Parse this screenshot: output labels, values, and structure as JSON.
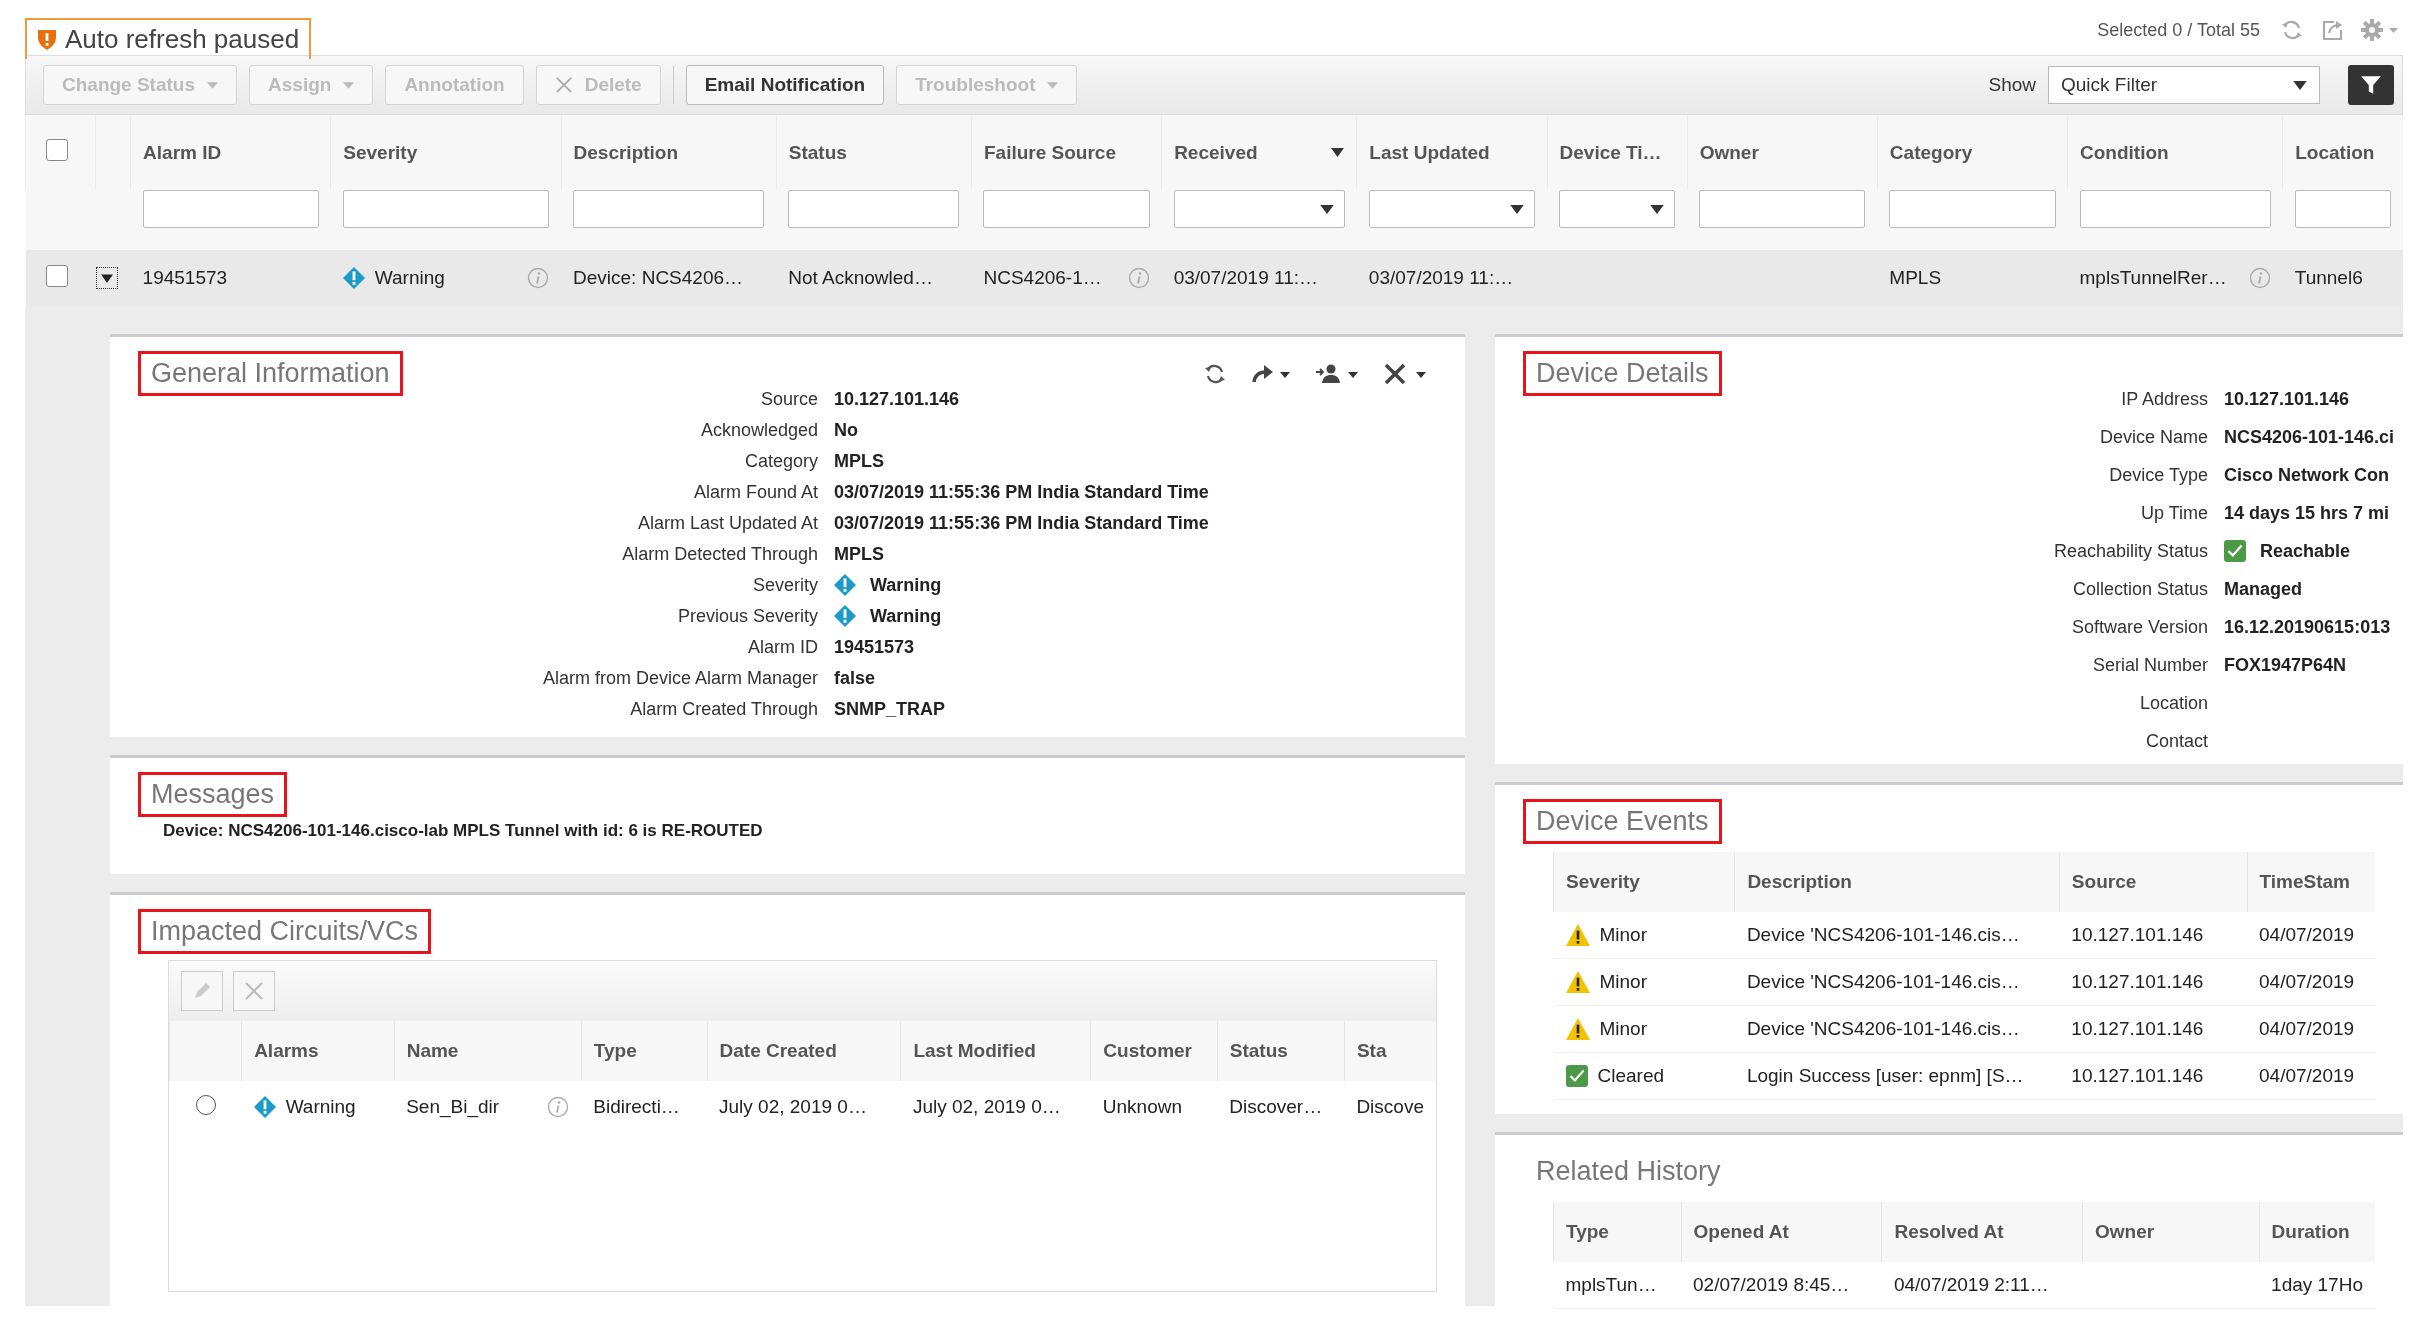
{
  "banner": {
    "text": "Auto refresh paused"
  },
  "summary": "Selected 0 / Total 55",
  "toolbar": {
    "buttons": [
      {
        "label": "Change Status",
        "kind": "menu",
        "disabled": true
      },
      {
        "label": "Assign",
        "kind": "menu",
        "disabled": true
      },
      {
        "label": "Annotation",
        "kind": "plain",
        "disabled": true
      },
      {
        "label": "Delete",
        "kind": "delete",
        "disabled": true
      },
      {
        "label": "Email Notification",
        "kind": "plain",
        "disabled": false
      },
      {
        "label": "Troubleshoot",
        "kind": "menu",
        "disabled": true
      }
    ],
    "show_label": "Show",
    "filter": {
      "value": "Quick Filter"
    }
  },
  "alarm_table": {
    "select_all": {
      "checked": false
    },
    "columns": [
      {
        "label": "Alarm ID",
        "kind": "text",
        "sorted": false
      },
      {
        "label": "Severity",
        "kind": "text",
        "sorted": false
      },
      {
        "label": "Description",
        "kind": "text",
        "sorted": false
      },
      {
        "label": "Status",
        "kind": "text",
        "sorted": false
      },
      {
        "label": "Failure Source",
        "kind": "text",
        "sorted": false
      },
      {
        "label": "Received",
        "kind": "select",
        "sorted": true
      },
      {
        "label": "Last Updated",
        "kind": "select",
        "sorted": false
      },
      {
        "label": "Device Ti…",
        "kind": "select",
        "sorted": false
      },
      {
        "label": "Owner",
        "kind": "text",
        "sorted": false
      },
      {
        "label": "Category",
        "kind": "text",
        "sorted": false
      },
      {
        "label": "Condition",
        "kind": "text",
        "sorted": false
      },
      {
        "label": "Location",
        "kind": "text",
        "sorted": false
      }
    ],
    "rows": [
      {
        "selected": false,
        "expanded": true,
        "cells": [
          {
            "text": "19451573"
          },
          {
            "text": "Warning",
            "kind": "warning",
            "info": true
          },
          {
            "text": "Device: NCS4206…"
          },
          {
            "text": "Not Acknowled…"
          },
          {
            "text": "NCS4206-1…",
            "info": true
          },
          {
            "text": "03/07/2019 11:…"
          },
          {
            "text": "03/07/2019 11:…"
          },
          null,
          null,
          {
            "text": "MPLS"
          },
          {
            "text": "mplsTunnelRer…",
            "info": true
          },
          {
            "text": "Tunnel6"
          }
        ]
      }
    ]
  },
  "general_information": {
    "title": "General Information",
    "highlighted": true,
    "fields": [
      {
        "label": "Source",
        "value": "10.127.101.146"
      },
      {
        "label": "Acknowledged",
        "value": "No"
      },
      {
        "label": "Category",
        "value": "MPLS"
      },
      {
        "label": "Alarm Found At",
        "value": "03/07/2019 11:55:36 PM India Standard Time"
      },
      {
        "label": "Alarm Last Updated At",
        "value": "03/07/2019 11:55:36 PM India Standard Time"
      },
      {
        "label": "Alarm Detected Through",
        "value": "MPLS"
      },
      {
        "label": "Severity",
        "value": "Warning",
        "kind": "warning"
      },
      {
        "label": "Previous Severity",
        "value": "Warning",
        "kind": "warning"
      },
      {
        "label": "Alarm ID",
        "value": "19451573"
      },
      {
        "label": "Alarm from Device Alarm Manager",
        "value": "false"
      },
      {
        "label": "Alarm Created Through",
        "value": "SNMP_TRAP"
      }
    ]
  },
  "messages": {
    "title": "Messages",
    "highlighted": true,
    "text": "Device: NCS4206-101-146.cisco-lab MPLS Tunnel with id: 6 is RE-ROUTED"
  },
  "impacted_circuits": {
    "title": "Impacted Circuits/VCs",
    "highlighted": true,
    "columns": [
      "Alarms",
      "Name",
      "Type",
      "Date Created",
      "Last Modified",
      "Customer",
      "Status",
      "Sta"
    ],
    "rows": [
      {
        "selected": false,
        "cells": [
          {
            "text": "Warning",
            "kind": "warning"
          },
          {
            "text": "Sen_Bi_dir",
            "info": true
          },
          {
            "text": "Bidirecti…"
          },
          {
            "text": "July 02, 2019 0…"
          },
          {
            "text": "July 02, 2019 0…"
          },
          {
            "text": "Unknown"
          },
          {
            "text": "Discover…"
          },
          {
            "text": "Discove"
          }
        ]
      }
    ]
  },
  "device_details": {
    "title": "Device Details",
    "highlighted": true,
    "fields": [
      {
        "label": "IP Address",
        "value": "10.127.101.146"
      },
      {
        "label": "Device Name",
        "value": "NCS4206-101-146.ci"
      },
      {
        "label": "Device Type",
        "value": "Cisco Network Con"
      },
      {
        "label": "Up Time",
        "value": "14 days 15 hrs 7 mi"
      },
      {
        "label": "Reachability Status",
        "value": "Reachable",
        "kind": "cleared"
      },
      {
        "label": "Collection Status",
        "value": "Managed"
      },
      {
        "label": "Software Version",
        "value": "16.12.20190615:013"
      },
      {
        "label": "Serial Number",
        "value": "FOX1947P64N"
      },
      {
        "label": "Location"
      },
      {
        "label": "Contact"
      }
    ]
  },
  "device_events": {
    "title": "Device Events",
    "highlighted": true,
    "columns": [
      "Severity",
      "Description",
      "Source",
      "TimeStam"
    ],
    "rows": [
      {
        "kind": "minor",
        "cells": [
          "Minor",
          "Device 'NCS4206-101-146.cis…",
          "10.127.101.146",
          "04/07/2019"
        ]
      },
      {
        "kind": "minor",
        "cells": [
          "Minor",
          "Device 'NCS4206-101-146.cis…",
          "10.127.101.146",
          "04/07/2019"
        ]
      },
      {
        "kind": "minor",
        "cells": [
          "Minor",
          "Device 'NCS4206-101-146.cis…",
          "10.127.101.146",
          "04/07/2019"
        ]
      },
      {
        "kind": "cleared",
        "cells": [
          "Cleared",
          "Login Success [user: epnm] [S…",
          "10.127.101.146",
          "04/07/2019"
        ]
      }
    ]
  },
  "related_history": {
    "title": "Related History",
    "highlighted": false,
    "columns": [
      "Type",
      "Opened At",
      "Resolved At",
      "Owner",
      "Duration"
    ],
    "rows": [
      {
        "cells": [
          "mplsTun…",
          "02/07/2019 8:45…",
          "04/07/2019 2:11…",
          null,
          "1day 17Ho"
        ]
      }
    ]
  }
}
